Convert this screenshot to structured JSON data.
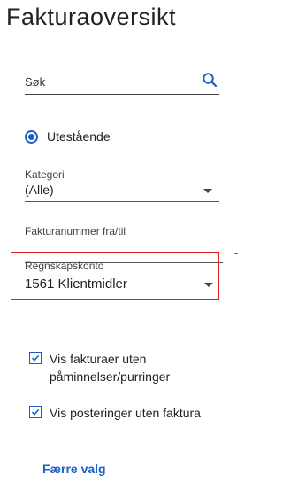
{
  "title": "Fakturaoversikt",
  "search": {
    "placeholder": "Søk",
    "value": "",
    "icon": "search-icon"
  },
  "status_filter": {
    "label": "Utestående",
    "selected": true
  },
  "category": {
    "label": "Kategori",
    "value": "(Alle)"
  },
  "invoice_range": {
    "label": "Fakturanummer fra/til",
    "value": "",
    "separator": "-"
  },
  "account": {
    "label": "Regnskapskonto",
    "value": "1561 Klientmidler"
  },
  "options": [
    {
      "label": "Vis fakturaer uten påminnelser/purringer",
      "checked": true
    },
    {
      "label": "Vis posteringer uten faktura",
      "checked": true
    }
  ],
  "fewer_options_label": "Færre valg",
  "colors": {
    "accent": "#1c5ec6",
    "highlight": "#e02020"
  }
}
